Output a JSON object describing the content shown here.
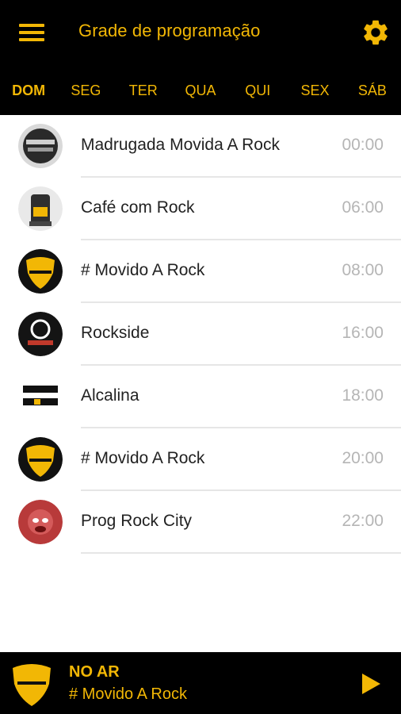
{
  "header": {
    "title": "Grade de programação",
    "menu_icon": "hamburger-menu-icon",
    "settings_icon": "gear-icon"
  },
  "tabs": [
    {
      "label": "DOM",
      "active": true
    },
    {
      "label": "SEG",
      "active": false
    },
    {
      "label": "TER",
      "active": false
    },
    {
      "label": "QUA",
      "active": false
    },
    {
      "label": "QUI",
      "active": false
    },
    {
      "label": "SEX",
      "active": false
    },
    {
      "label": "SÁB",
      "active": false
    }
  ],
  "schedule": [
    {
      "name": "Madrugada Movida A Rock",
      "time": "00:00",
      "avatar": "madrugada-logo"
    },
    {
      "name": "Café com Rock",
      "time": "06:00",
      "avatar": "cafe-com-rock-logo"
    },
    {
      "name": "# Movido A Rock",
      "time": "08:00",
      "avatar": "movido-a-rock-logo"
    },
    {
      "name": "Rockside",
      "time": "16:00",
      "avatar": "rockside-logo"
    },
    {
      "name": "Alcalina",
      "time": "18:00",
      "avatar": "alcalina-logo"
    },
    {
      "name": "# Movido A Rock",
      "time": "20:00",
      "avatar": "movido-a-rock-logo"
    },
    {
      "name": "Prog Rock City",
      "time": "22:00",
      "avatar": "prog-rock-city-logo"
    }
  ],
  "player": {
    "status": "NO AR",
    "track": "# Movido A Rock",
    "play_icon": "play-icon"
  },
  "colors": {
    "accent": "#f2b705",
    "bar_background": "#000000",
    "time_text": "#b5b5b5"
  }
}
